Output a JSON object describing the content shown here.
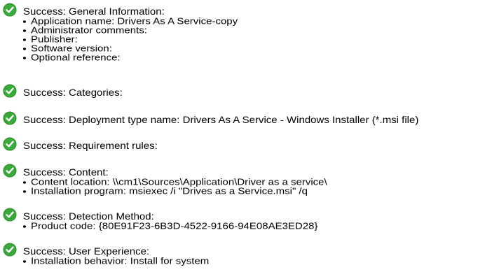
{
  "status_prefix": "Success:",
  "icon": "green-checkmark-circle",
  "colors": {
    "check_green": "#3aa83a",
    "check_mark": "#ffffff",
    "text": "#000000",
    "background": "#ffffff"
  },
  "sections": [
    {
      "heading": "Success: General Information:",
      "items": [
        "Application name: Drivers As A Service-copy",
        "Administrator comments:",
        "Publisher:",
        "Software version:",
        "Optional reference:"
      ]
    },
    {
      "heading": "Success: Categories:",
      "items": []
    },
    {
      "heading": "Success: Deployment type name: Drivers As A Service - Windows Installer (*.msi file)",
      "items": []
    },
    {
      "heading": "Success: Requirement rules:",
      "items": []
    },
    {
      "heading": "Success: Content:",
      "items": [
        "Content location: \\\\cm1\\Sources\\Application\\Driver as a service\\",
        "Installation program: msiexec /i \"Drives as a Service.msi\" /q"
      ]
    },
    {
      "heading": "Success: Detection Method:",
      "items": [
        "Product code: {80E91F23-6B3D-4522-9166-94E08AE3ED28}"
      ]
    },
    {
      "heading": "Success: User Experience:",
      "items": [
        "Installation behavior: Install for system"
      ]
    }
  ]
}
